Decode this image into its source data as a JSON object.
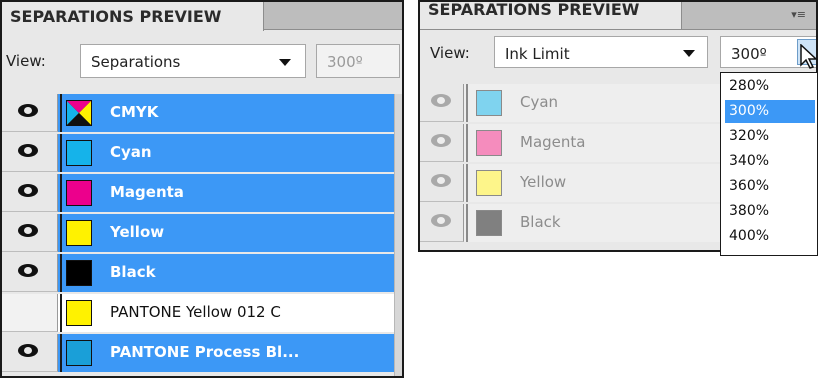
{
  "left_panel": {
    "title": "SEPARATIONS PREVIEW",
    "view_label": "View:",
    "view_value": "Separations",
    "ink_limit_value": "300º",
    "rows": [
      {
        "label": "CMYK",
        "visible": true,
        "swatch": "cmyk"
      },
      {
        "label": "Cyan",
        "visible": true,
        "swatch": "#15b3ea"
      },
      {
        "label": "Magenta",
        "visible": true,
        "swatch": "#ec008c"
      },
      {
        "label": "Yellow",
        "visible": true,
        "swatch": "#fff200"
      },
      {
        "label": "Black",
        "visible": true,
        "swatch": "#000000"
      },
      {
        "label": "PANTONE Yellow 012 C",
        "visible": false,
        "swatch": "#fff200"
      },
      {
        "label": "PANTONE Process Bl...",
        "visible": true,
        "swatch": "#1a9fd8"
      }
    ]
  },
  "right_panel": {
    "title": "SEPARATIONS PREVIEW",
    "view_label": "View:",
    "view_value": "Ink Limit",
    "ink_limit_value": "300º",
    "rows": [
      {
        "label": "Cyan",
        "swatch": "#7fd3ef"
      },
      {
        "label": "Magenta",
        "swatch": "#f58cbd"
      },
      {
        "label": "Yellow",
        "swatch": "#fdf58a"
      },
      {
        "label": "Black",
        "swatch": "#808080"
      }
    ],
    "dropdown_options": [
      "280%",
      "300%",
      "320%",
      "340%",
      "360%",
      "380%",
      "400%"
    ],
    "dropdown_selected": "300%"
  },
  "colors": {
    "selection": "#3c98f6",
    "panel": "#e8e8e8"
  }
}
